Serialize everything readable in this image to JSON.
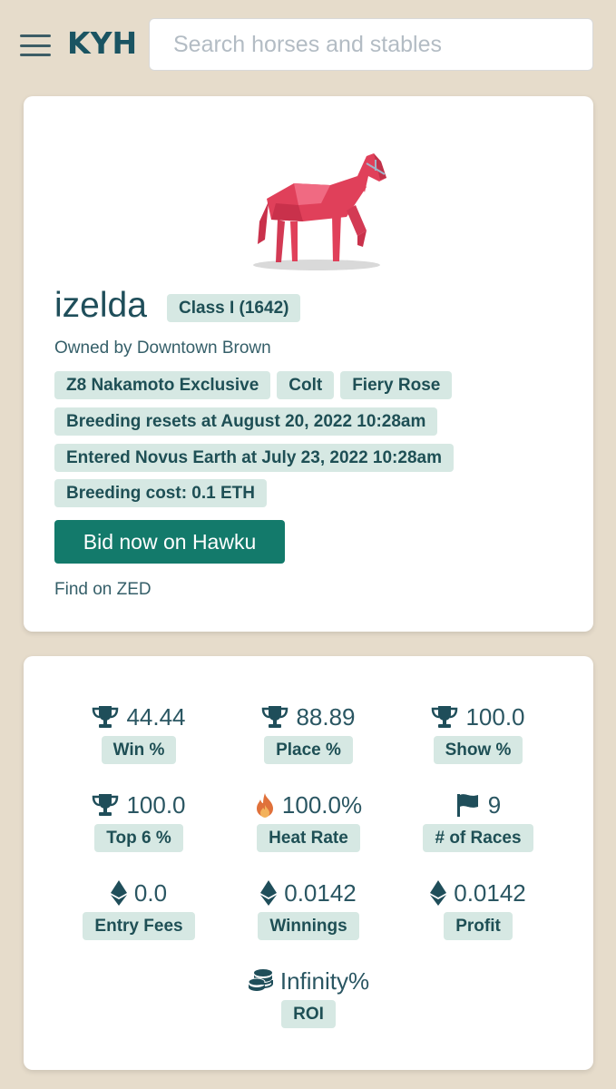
{
  "header": {
    "logo": "KYH",
    "search_placeholder": "Search horses and stables"
  },
  "horse": {
    "name": "izelda",
    "class": "Class I (1642)",
    "owner": "Owned by Downtown Brown",
    "tags": [
      "Z8 Nakamoto Exclusive",
      "Colt",
      "Fiery Rose"
    ],
    "breeding_resets": "Breeding resets at August 20, 2022 10:28am",
    "entered": "Entered Novus Earth at July 23, 2022 10:28am",
    "breeding_cost": "Breeding cost: 0.1 ETH",
    "bid_button": "Bid now on Hawku",
    "zed_link": "Find on ZED",
    "coat_color": "#e0405a"
  },
  "stats": [
    {
      "icon": "trophy-icon",
      "value": "44.44",
      "label": "Win %"
    },
    {
      "icon": "trophy-icon",
      "value": "88.89",
      "label": "Place %"
    },
    {
      "icon": "trophy-icon",
      "value": "100.0",
      "label": "Show %"
    },
    {
      "icon": "trophy-icon",
      "value": "100.0",
      "label": "Top 6 %"
    },
    {
      "icon": "fire-icon",
      "value": "100.0%",
      "label": "Heat Rate"
    },
    {
      "icon": "flag-icon",
      "value": "9",
      "label": "# of Races"
    },
    {
      "icon": "ethereum-icon",
      "value": "0.0",
      "label": "Entry Fees"
    },
    {
      "icon": "ethereum-icon",
      "value": "0.0142",
      "label": "Winnings"
    },
    {
      "icon": "ethereum-icon",
      "value": "0.0142",
      "label": "Profit"
    },
    {
      "icon": "coins-icon",
      "value": "Infinity%",
      "label": "ROI"
    }
  ],
  "colors": {
    "background": "#e6dccb",
    "accent": "#137a6b",
    "badge_bg": "#d6e8e3",
    "text": "#1f4e5a",
    "fire": "#e0713a"
  }
}
